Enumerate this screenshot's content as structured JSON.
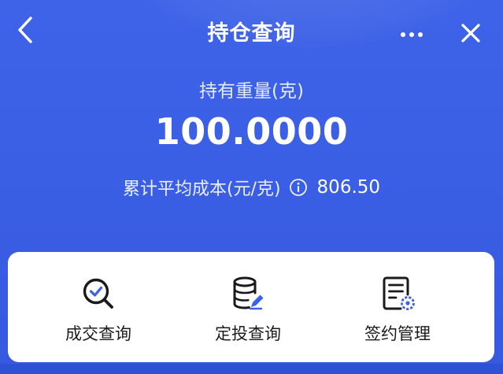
{
  "navbar": {
    "title": "持仓查询",
    "back_icon": "chevron-left-icon",
    "more_icon": "more-horizontal-icon",
    "close_icon": "close-icon"
  },
  "summary": {
    "holding_label": "持有重量(克)",
    "holding_value": "100.0000",
    "cost_label": "累计平均成本(元/克)",
    "cost_info_icon": "info-icon",
    "cost_value": "806.50"
  },
  "actions": [
    {
      "label": "成交查询",
      "icon": "search-check-icon"
    },
    {
      "label": "定投查询",
      "icon": "coin-stack-edit-icon"
    },
    {
      "label": "签约管理",
      "icon": "document-settings-icon"
    }
  ],
  "colors": {
    "background": "#3a5fe0",
    "card": "#ffffff",
    "icon_primary": "#1a1a1a",
    "icon_accent": "#3c60e6"
  }
}
